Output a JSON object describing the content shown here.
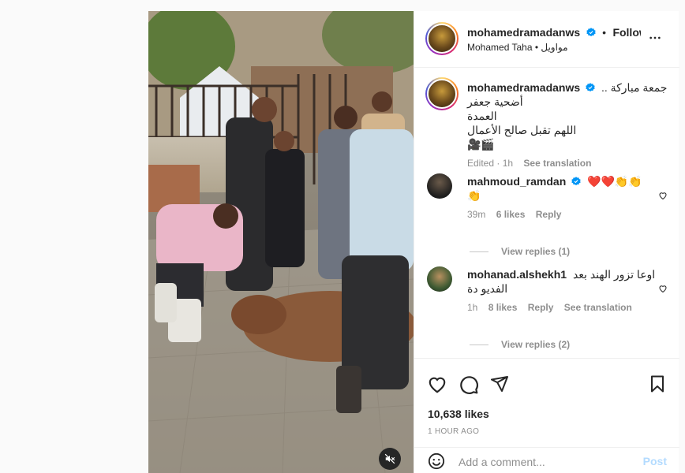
{
  "post": {
    "author": "mohamedramadanws",
    "follow_label": "Following",
    "subtitle": "Mohamed Taha • مواويل",
    "caption_line1": "جمعة مباركة .. ",
    "caption_line2": "أضحية جعفر العمدة",
    "caption_line3": "اللهم تقبل صالح الأعمال",
    "caption_emoji": "🎥🎬",
    "caption_meta_edited": "Edited · 1h",
    "see_translation": "See translation"
  },
  "comments": [
    {
      "username": "mahmoud_ramdan",
      "text": "❤️❤️👏👏",
      "text2": "👏",
      "time": "39m",
      "likes": "6 likes",
      "reply": "Reply",
      "view_replies": "View replies (1)"
    },
    {
      "username": "mohanad.alshekh1",
      "text": "اوعا تزور الهند بعد",
      "text2": "الفديو دة",
      "time": "1h",
      "likes": "8 likes",
      "reply": "Reply",
      "see_translation": "See translation",
      "view_replies": "View replies (2)"
    }
  ],
  "stats": {
    "likes": "10,638 likes",
    "time_ago": "1 HOUR AGO"
  },
  "composer": {
    "placeholder": "Add a comment...",
    "post_label": "Post"
  },
  "colors": {
    "verified": "#0095f6",
    "post_disabled": "#b3dbff",
    "heart_red": "#ed4956"
  },
  "icons": [
    "more-icon",
    "heart-icon",
    "comment-icon",
    "share-icon",
    "bookmark-icon",
    "emoji-icon",
    "mute-icon",
    "verified-icon"
  ]
}
